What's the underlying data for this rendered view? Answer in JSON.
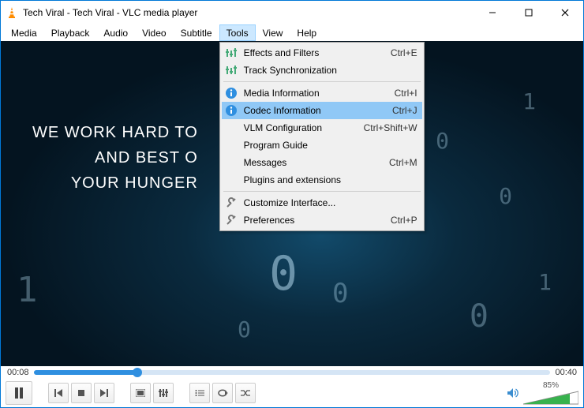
{
  "titlebar": {
    "title": "Tech Viral - Tech Viral - VLC media player"
  },
  "menubar": [
    "Media",
    "Playback",
    "Audio",
    "Video",
    "Subtitle",
    "Tools",
    "View",
    "Help"
  ],
  "tools_menu": [
    {
      "icon": "equalizer",
      "label": "Effects and Filters",
      "shortcut": "Ctrl+E"
    },
    {
      "icon": "equalizer",
      "label": "Track Synchronization",
      "shortcut": ""
    },
    {
      "sep": true
    },
    {
      "icon": "info",
      "label": "Media Information",
      "shortcut": "Ctrl+I"
    },
    {
      "icon": "info",
      "label": "Codec Information",
      "shortcut": "Ctrl+J",
      "highlight": true
    },
    {
      "icon": "",
      "label": "VLM Configuration",
      "shortcut": "Ctrl+Shift+W"
    },
    {
      "icon": "",
      "label": "Program Guide",
      "shortcut": ""
    },
    {
      "icon": "",
      "label": "Messages",
      "shortcut": "Ctrl+M"
    },
    {
      "icon": "",
      "label": "Plugins and extensions",
      "shortcut": ""
    },
    {
      "sep": true
    },
    {
      "icon": "wrench",
      "label": "Customize Interface...",
      "shortcut": ""
    },
    {
      "icon": "wrench",
      "label": "Preferences",
      "shortcut": "Ctrl+P"
    }
  ],
  "video": {
    "line1": "WE WORK HARD TO",
    "line2": "AND BEST O",
    "line3": "YOUR HUNGER"
  },
  "playback": {
    "current": "00:08",
    "total": "00:40",
    "volume_pct": "85%"
  }
}
